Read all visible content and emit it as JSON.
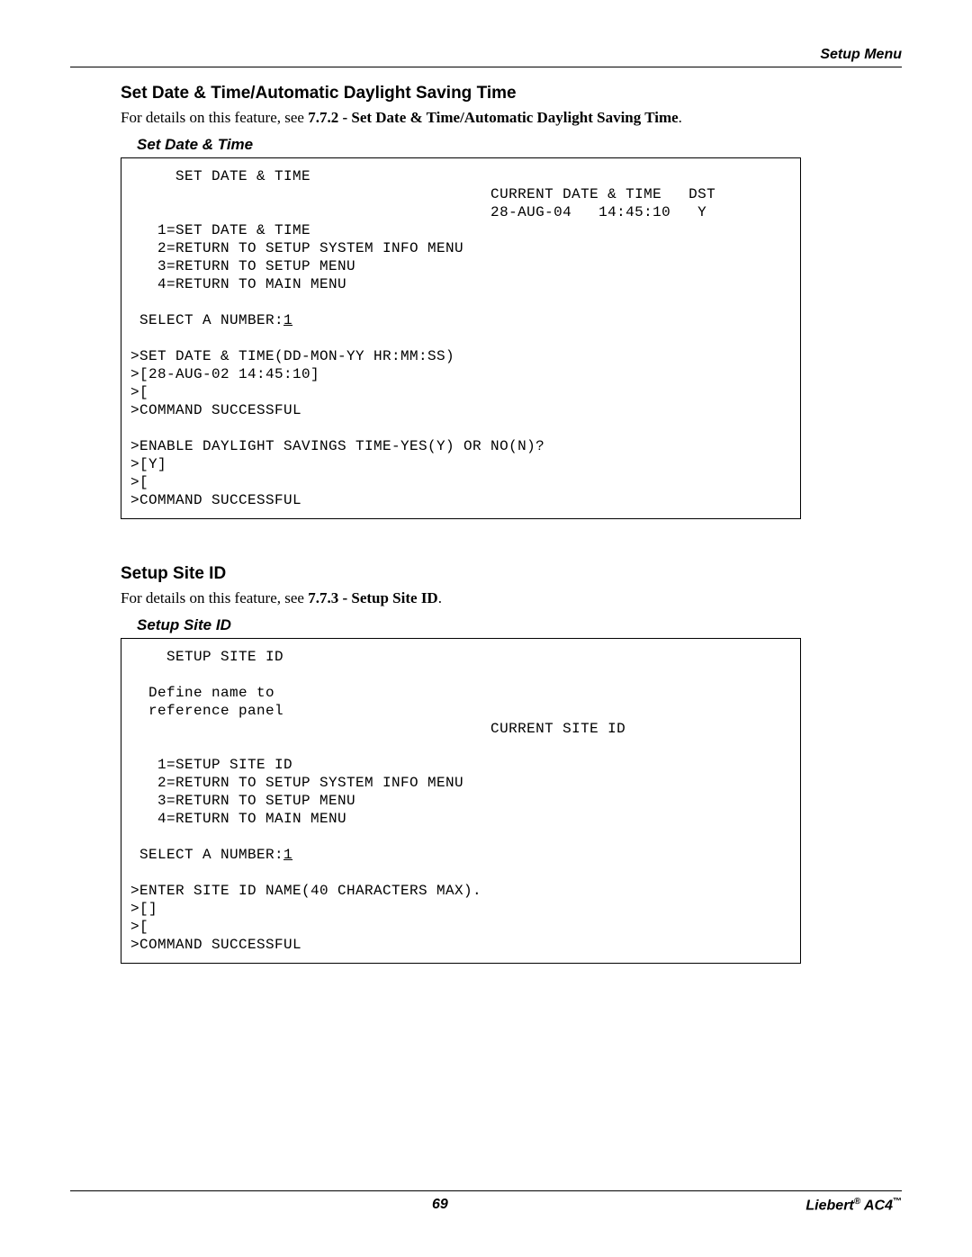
{
  "header": {
    "right": "Setup Menu"
  },
  "sections": {
    "datetime": {
      "title": "Set Date & Time/Automatic Daylight Saving Time",
      "intro_prefix": "For details on this feature, see ",
      "intro_bold": "7.7.2 - Set Date & Time/Automatic Daylight Saving Time",
      "intro_suffix": ".",
      "subhead": "Set Date & Time",
      "terminal": "     SET DATE & TIME\n                                        CURRENT DATE & TIME   DST\n                                        28-AUG-04   14:45:10   Y\n   1=SET DATE & TIME\n   2=RETURN TO SETUP SYSTEM INFO MENU\n   3=RETURN TO SETUP MENU\n   4=RETURN TO MAIN MENU\n\n SELECT A NUMBER:",
      "terminal_input": "1",
      "terminal_after": "\n\n>SET DATE & TIME(DD-MON-YY HR:MM:SS)\n>[28-AUG-02 14:45:10]\n>[\n>COMMAND SUCCESSFUL\n\n>ENABLE DAYLIGHT SAVINGS TIME-YES(Y) OR NO(N)?\n>[Y]\n>[\n>COMMAND SUCCESSFUL"
    },
    "siteid": {
      "title": "Setup Site ID",
      "intro_prefix": "For details on this feature, see ",
      "intro_bold": "7.7.3 - Setup Site ID",
      "intro_suffix": ".",
      "subhead": "Setup Site ID",
      "terminal": "    SETUP SITE ID\n\n  Define name to\n  reference panel\n                                        CURRENT SITE ID\n\n   1=SETUP SITE ID\n   2=RETURN TO SETUP SYSTEM INFO MENU\n   3=RETURN TO SETUP MENU\n   4=RETURN TO MAIN MENU\n\n SELECT A NUMBER:",
      "terminal_input": "1",
      "terminal_after": "\n\n>ENTER SITE ID NAME(40 CHARACTERS MAX).\n>[]\n>[\n>COMMAND SUCCESSFUL"
    }
  },
  "footer": {
    "page": "69",
    "brand_a": "Liebert",
    "brand_b": "AC4"
  }
}
